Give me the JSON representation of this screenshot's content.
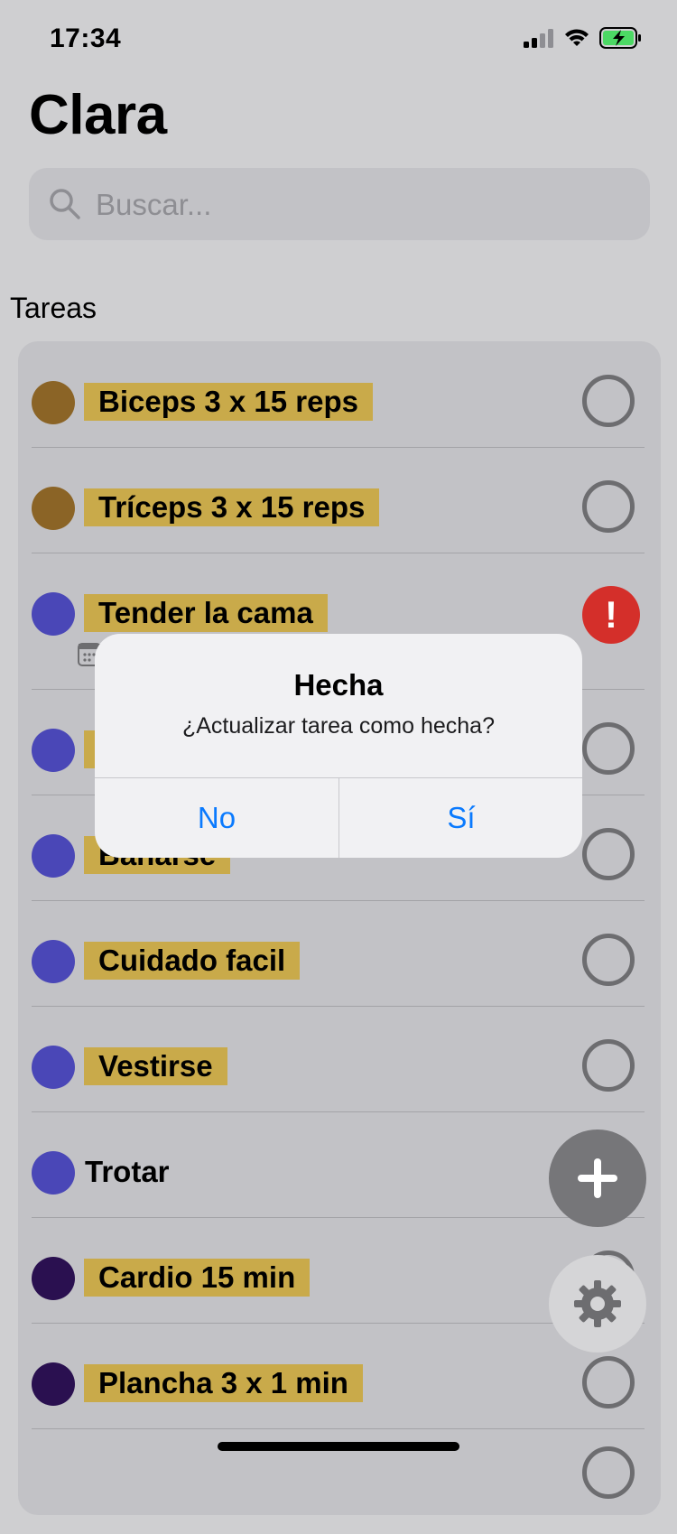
{
  "status_bar": {
    "time": "17:34",
    "icons": [
      "cellular-signal-icon",
      "wifi-icon",
      "battery-charging-icon"
    ],
    "battery_color": "#4cd964"
  },
  "header": {
    "title": "Clara"
  },
  "search": {
    "placeholder": "Buscar..."
  },
  "section": {
    "label": "Tareas"
  },
  "colors": {
    "highlight": "#c9aa4a",
    "brown": "#8b6426",
    "blue": "#4a47b7",
    "purple": "#2a1050",
    "alert_red": "#d42f2a",
    "accent_blue": "#0a7afe"
  },
  "tasks": [
    {
      "label": "Biceps 3 x 15 reps",
      "dot": "brown",
      "status": "pending"
    },
    {
      "label": "Tríceps 3 x 15 reps",
      "dot": "brown",
      "status": "pending"
    },
    {
      "label": "Tender la cama",
      "dot": "blue",
      "status": "overdue",
      "has_calendar_icon": true
    },
    {
      "label": "",
      "dot": "blue",
      "status": "pending"
    },
    {
      "label": "Bañarse",
      "dot": "blue",
      "status": "pending"
    },
    {
      "label": "Cuidado facil",
      "dot": "blue",
      "status": "pending"
    },
    {
      "label": "Vestirse",
      "dot": "blue",
      "status": "pending"
    },
    {
      "label": "Trotar",
      "dot": "blue",
      "status": "pending"
    },
    {
      "label": "Cardio 15 min",
      "dot": "purple",
      "status": "pending"
    },
    {
      "label": "Plancha 3 x 1 min",
      "dot": "purple",
      "status": "pending"
    }
  ],
  "alert": {
    "title": "Hecha",
    "message": "¿Actualizar tarea como hecha?",
    "cancel_label": "No",
    "confirm_label": "Sí"
  },
  "fabs": {
    "add_icon": "plus-icon",
    "settings_icon": "gear-icon"
  }
}
